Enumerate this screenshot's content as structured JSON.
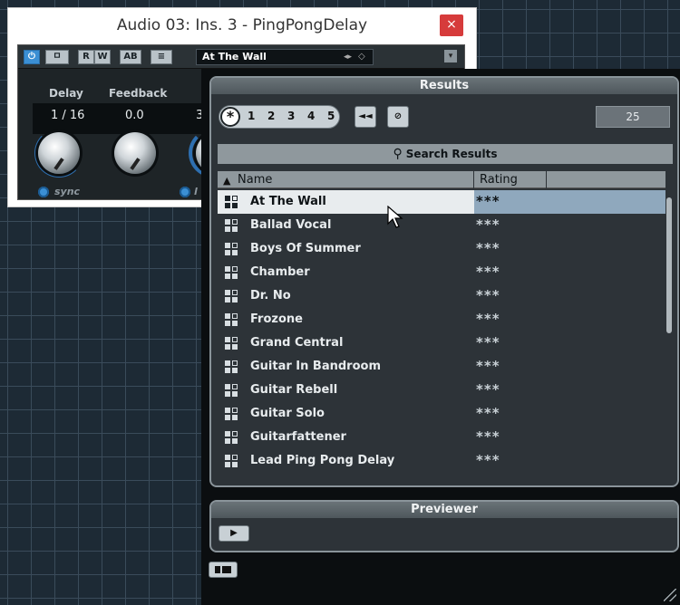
{
  "plugin": {
    "title": "Audio 03: Ins. 3 - PingPongDelay",
    "close_label": "×",
    "toolbar": {
      "power_label": "⏻",
      "compare_label": "ㅁ",
      "read_label": "R",
      "write_label": "W",
      "ab_label": "AB",
      "menu_label": "≡",
      "preset": "At The Wall",
      "preset_arrows": "◂▸",
      "preset_tag": "◇",
      "dropdown_label": "▾"
    },
    "params": [
      {
        "label": "Delay",
        "value": "1 / 16"
      },
      {
        "label": "Feedback",
        "value": "0.0"
      },
      {
        "label": "",
        "value": "3"
      }
    ],
    "sync_label": "sync",
    "sync2_label": "l"
  },
  "results": {
    "header": "Results",
    "filter": {
      "all": "*",
      "levels": [
        "1",
        "2",
        "3",
        "4",
        "5"
      ]
    },
    "prev_button": "◄◄",
    "reset_button": "⊘",
    "count": "25",
    "search_label": "Search Results",
    "columns": {
      "name": "Name",
      "rating": "Rating"
    },
    "rows": [
      {
        "name": "At The Wall",
        "rating": "***"
      },
      {
        "name": "Ballad Vocal",
        "rating": "***"
      },
      {
        "name": "Boys Of Summer",
        "rating": "***"
      },
      {
        "name": "Chamber",
        "rating": "***"
      },
      {
        "name": "Dr. No",
        "rating": "***"
      },
      {
        "name": "Frozone",
        "rating": "***"
      },
      {
        "name": "Grand Central",
        "rating": "***"
      },
      {
        "name": "Guitar In Bandroom",
        "rating": "***"
      },
      {
        "name": "Guitar Rebell",
        "rating": "***"
      },
      {
        "name": "Guitar Solo",
        "rating": "***"
      },
      {
        "name": "Guitarfattener",
        "rating": "***"
      },
      {
        "name": "Lead Ping Pong Delay",
        "rating": "***"
      }
    ]
  },
  "previewer": {
    "header": "Previewer",
    "play_label": "▶"
  },
  "colors": {
    "accent": "#3b8fd4",
    "selected_row": "#e8ecee",
    "selected_rating": "#8fa8bd",
    "panel_bg": "#2d3338"
  }
}
